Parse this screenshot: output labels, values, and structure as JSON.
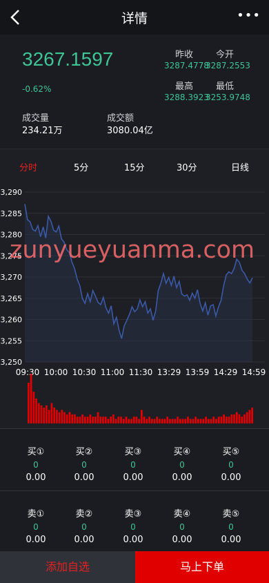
{
  "header": {
    "title": "详情",
    "more": "•••"
  },
  "quote": {
    "price": "3267.1597",
    "change_pct": "-0.62%",
    "volume_label": "成交量",
    "volume_value": "234.21万",
    "amount_label": "成交额",
    "amount_value": "3080.04亿",
    "prev_close_label": "昨收",
    "prev_close_value": "3287.4778",
    "open_label": "今开",
    "open_value": "3287.2553",
    "high_label": "最高",
    "high_value": "3288.3923",
    "low_label": "最低",
    "low_value": "3253.9748"
  },
  "tabs": [
    "分时",
    "5分",
    "15分",
    "30分",
    "日线"
  ],
  "chart_data": {
    "type": "area",
    "x_ticks": [
      "09:30",
      "10:00",
      "10:30",
      "11:00",
      "11:30",
      "13:29",
      "13:59",
      "14:29",
      "14:59"
    ],
    "y_ticks": [
      "3,290",
      "3,285",
      "3,280",
      "3,275",
      "3,270",
      "3,265",
      "3,260",
      "3,255",
      "3,250"
    ],
    "ylim": [
      3250,
      3290
    ],
    "line_color": "#3a5aa8",
    "volume_color": "#e00000",
    "price_series": [
      3287.2,
      3283.5,
      3283.0,
      3281.2,
      3280.8,
      3282.1,
      3279.5,
      3281.8,
      3279.2,
      3284.3,
      3283.1,
      3281.0,
      3280.6,
      3282.0,
      3279.0,
      3278.2,
      3276.4,
      3275.8,
      3273.5,
      3272.0,
      3269.5,
      3268.0,
      3265.0,
      3263.8,
      3266.1,
      3264.2,
      3266.8,
      3265.5,
      3264.0,
      3263.5,
      3265.2,
      3262.8,
      3261.5,
      3263.2,
      3259.0,
      3260.5,
      3257.5,
      3255.5,
      3258.5,
      3259.8,
      3261.2,
      3263.0,
      3261.8,
      3262.5,
      3264.6,
      3263.0,
      3264.2,
      3261.5,
      3262.5,
      3259.8,
      3262.0,
      3266.8,
      3268.5,
      3270.8,
      3268.5,
      3269.9,
      3268.0,
      3270.2,
      3267.5,
      3269.0,
      3266.0,
      3265.5,
      3265.8,
      3264.5,
      3266.2,
      3265.0,
      3267.0,
      3263.8,
      3262.0,
      3263.9,
      3261.0,
      3263.2,
      3263.5,
      3260.8,
      3262.9,
      3264.5,
      3268.0,
      3270.5,
      3271.2,
      3270.8,
      3272.0,
      3274.2,
      3273.5,
      3271.6,
      3270.8,
      3269.5,
      3268.6,
      3269.8
    ],
    "volume_series": [
      18,
      22,
      14,
      11,
      9,
      8,
      7,
      8,
      6,
      9,
      7,
      6,
      5,
      6,
      5,
      4,
      5,
      4,
      4,
      3,
      3,
      4,
      3,
      3,
      4,
      3,
      3,
      5,
      3,
      3,
      3,
      2,
      3,
      4,
      2,
      3,
      3,
      2,
      3,
      2,
      2,
      3,
      3,
      2,
      6,
      3,
      2,
      3,
      2,
      2,
      3,
      2,
      2,
      2,
      3,
      2,
      2,
      2,
      3,
      2,
      2,
      2,
      3,
      2,
      2,
      3,
      2,
      2,
      2,
      3,
      2,
      2,
      3,
      2,
      3,
      3,
      4,
      3,
      3,
      4,
      4,
      5,
      4,
      3,
      4,
      5,
      6,
      7
    ]
  },
  "book": {
    "buy": [
      {
        "name": "买①",
        "vol": "0",
        "price": "0.00"
      },
      {
        "name": "买②",
        "vol": "0",
        "price": "0.00"
      },
      {
        "name": "买③",
        "vol": "0",
        "price": "0.00"
      },
      {
        "name": "买④",
        "vol": "0",
        "price": "0.00"
      },
      {
        "name": "买⑤",
        "vol": "0",
        "price": "0.00"
      }
    ],
    "sell": [
      {
        "name": "卖①",
        "vol": "0",
        "price": "0.00"
      },
      {
        "name": "卖②",
        "vol": "0",
        "price": "0.00"
      },
      {
        "name": "卖③",
        "vol": "0",
        "price": "0.00"
      },
      {
        "name": "卖④",
        "vol": "0",
        "price": "0.00"
      },
      {
        "name": "卖⑤",
        "vol": "0",
        "price": "0.00"
      }
    ]
  },
  "footer": {
    "add_watchlist": "添加自选",
    "order_now": "马上下单"
  },
  "watermark": "zunyueyuanma.com"
}
